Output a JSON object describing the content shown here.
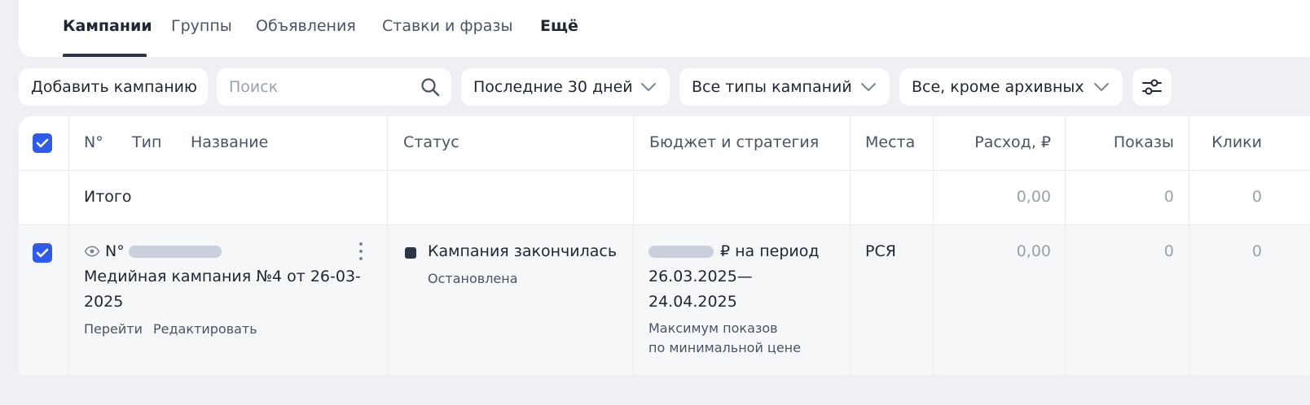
{
  "tabs": [
    {
      "label": "Кампании",
      "active": true
    },
    {
      "label": "Группы",
      "active": false
    },
    {
      "label": "Объявления",
      "active": false
    },
    {
      "label": "Ставки и фразы",
      "active": false
    },
    {
      "label": "Ещё",
      "active": false
    }
  ],
  "toolbar": {
    "add_label": "Добавить кампанию",
    "search_placeholder": "Поиск",
    "period_label": "Последние 30 дней",
    "types_label": "Все типы кампаний",
    "archive_label": "Все, кроме архивных",
    "settings_icon": "sliders-icon"
  },
  "table": {
    "columns": {
      "num": "N°",
      "type": "Тип",
      "name": "Название",
      "status": "Статус",
      "budget": "Бюджет и стратегия",
      "places": "Места",
      "spend": "Расход, ₽",
      "impressions": "Показы",
      "clicks": "Клики"
    },
    "total": {
      "label": "Итого",
      "spend": "0,00",
      "impressions": "0",
      "clicks": "0"
    },
    "campaign": {
      "num_prefix": "N°",
      "name_line1": "Медийная кампания №4 от 26-03-",
      "name_line2": "2025",
      "link_go": "Перейти",
      "link_edit": "Редактировать",
      "status": "Кампания закончилась",
      "status_sub": "Остановлена",
      "budget_suffix": "₽ на период",
      "period_line1": "26.03.2025—",
      "period_line2": "24.04.2025",
      "strategy_line1": "Максимум показов",
      "strategy_line2": "по минимальной цене",
      "places": "РСЯ",
      "spend": "0,00",
      "impressions": "0",
      "clicks": "0"
    }
  },
  "colors": {
    "accent": "#2f5bea",
    "background": "#eef0f4",
    "text": "#1f2533",
    "muted": "#9aa1ad"
  }
}
